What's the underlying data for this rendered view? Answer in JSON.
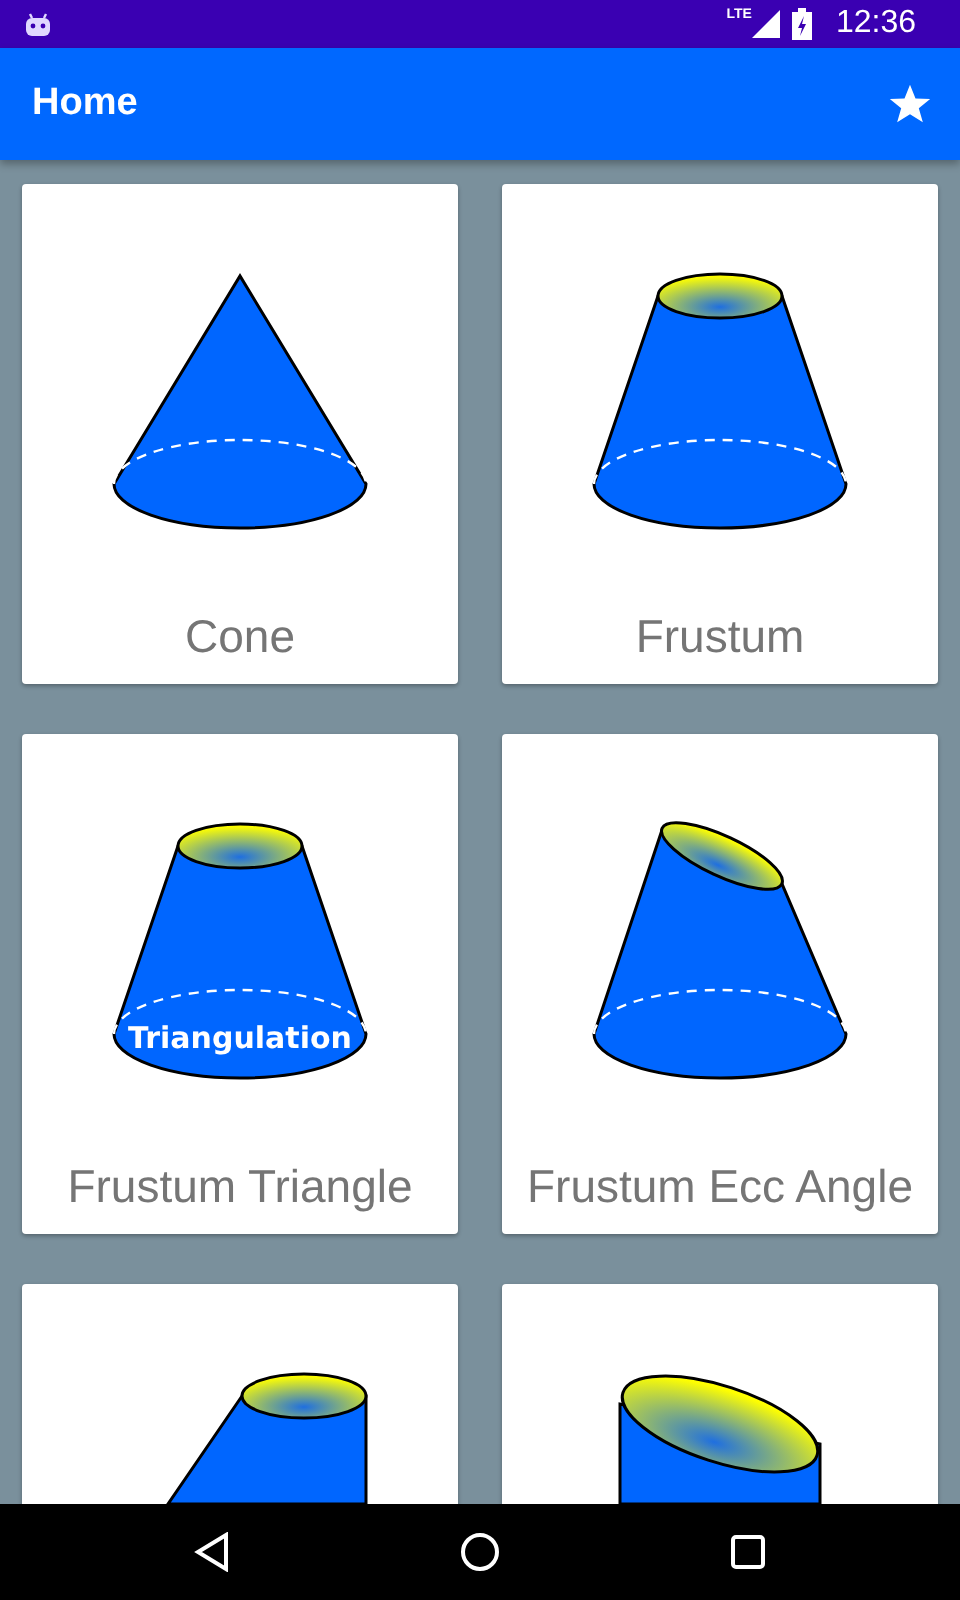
{
  "status_bar": {
    "time": "12:36",
    "network": "LTE"
  },
  "app_bar": {
    "title": "Home"
  },
  "cards": [
    {
      "kind": "cone",
      "title": "Cone"
    },
    {
      "kind": "frustum",
      "title": "Frustum"
    },
    {
      "kind": "frustum-triangle",
      "title": "Frustum Triangle",
      "overlay_label": "Triangulation"
    },
    {
      "kind": "frustum-ecc",
      "title": "Frustum Ecc Angle"
    },
    {
      "kind": "oblique"
    },
    {
      "kind": "cylinder-ecc"
    }
  ]
}
